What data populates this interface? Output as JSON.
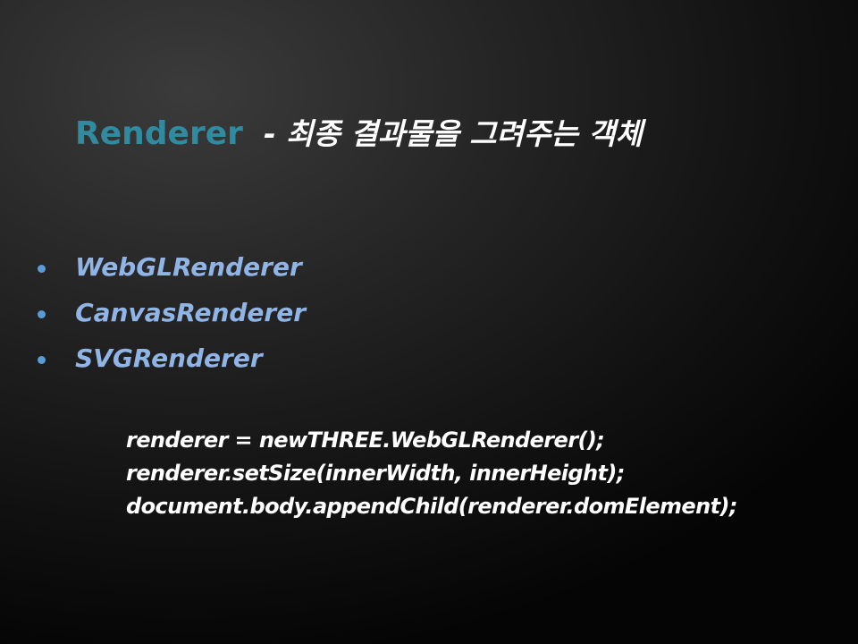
{
  "title": {
    "main": "Renderer",
    "subtitle": "- 최종 결과물을 그려주는 객체"
  },
  "bullets": [
    {
      "label": "WebGLRenderer"
    },
    {
      "label": "CanvasRenderer"
    },
    {
      "label": "SVGRenderer"
    }
  ],
  "code": {
    "lines": [
      "renderer = newTHREE.WebGLRenderer();",
      "renderer.setSize(innerWidth, innerHeight);",
      "document.body.appendChild(renderer.domElement);"
    ]
  },
  "colors": {
    "title_accent": "#318ba0",
    "bullet_text": "#90b4e6",
    "bullet_dot": "#5b9bd5",
    "code_text": "#ffffff"
  }
}
